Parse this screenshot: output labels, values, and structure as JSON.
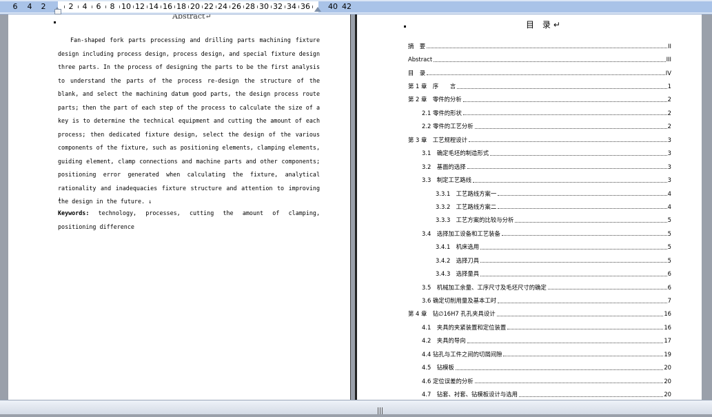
{
  "ruler": {
    "numbers": [
      "6",
      "4",
      "2",
      "2",
      "4",
      "6",
      "8",
      "10",
      "12",
      "14",
      "16",
      "18",
      "20",
      "22",
      "24",
      "26",
      "28",
      "30",
      "32",
      "34",
      "36",
      "40",
      "42"
    ]
  },
  "left_page": {
    "title": "Abstract↵",
    "body": "Fan-shaped fork parts processing and drilling parts machining fixture design including process design, process design, and special fixture design three parts. In the process of designing the parts to be the first analysis to understand the parts of the process re-design the structure of the blank, and select the machining datum good parts, the design process route parts; then the part of each step of the process to calculate the size of a key is to determine the technical equipment and cutting the amount of each process; then dedicated fixture design, select the design of the various components of the fixture, such as positioning elements, clamping elements, guiding element, clamp connections and machine parts and other components; positioning error generated when calculating the fixture, analytical rationality and inadequacies fixture structure and attention to improving the design in the future. ↓",
    "empty_line": "↓",
    "keywords_label": "Keywords:",
    "keywords_text": " technology, processes, cutting the amount of clamping, positioning difference"
  },
  "right_page": {
    "toc_title": "目 录↵",
    "entries": [
      {
        "label": "摘　要",
        "page": "II",
        "level": 1
      },
      {
        "label": "Abstract",
        "page": "III",
        "level": 1
      },
      {
        "label": "目　录",
        "page": "IV",
        "level": 1
      },
      {
        "label": "第 1 章　序　　言",
        "page": "1",
        "level": 1
      },
      {
        "label": "第 2 章　零件的分析",
        "page": "2",
        "level": 1
      },
      {
        "label": "2.1 零件的形状",
        "page": "2",
        "level": 2
      },
      {
        "label": "2.2 零件的工艺分析",
        "page": "2",
        "level": 2
      },
      {
        "label": "第 3 章　工艺规程设计",
        "page": "3",
        "level": 1
      },
      {
        "label": "3.1　确定毛坯的制造形式",
        "page": "3",
        "level": 2
      },
      {
        "label": "3.2　基面的选择",
        "page": "3",
        "level": 2
      },
      {
        "label": "3.3　制定工艺路线",
        "page": "3",
        "level": 2
      },
      {
        "label": "3.3.1　工艺路线方案一",
        "page": "4",
        "level": 3
      },
      {
        "label": "3.3.2　工艺路线方案二",
        "page": "4",
        "level": 3
      },
      {
        "label": "3.3.3　工艺方案的比较与分析",
        "page": "5",
        "level": 3
      },
      {
        "label": "3.4　选择加工设备和工艺装备",
        "page": "5",
        "level": 2
      },
      {
        "label": "3.4.1　机床选用",
        "page": "5",
        "level": 3
      },
      {
        "label": "3.4.2　选择刀具",
        "page": "5",
        "level": 3
      },
      {
        "label": "3.4.3　选择量具",
        "page": "6",
        "level": 3
      },
      {
        "label": "3.5　机械加工余量、工序尺寸及毛坯尺寸的确定",
        "page": "6",
        "level": 2
      },
      {
        "label": "3.6 确定切削用量及基本工时",
        "page": "7",
        "level": 2
      },
      {
        "label": "第 4 章　钻∅16H7 孔孔夹具设计",
        "page": "16",
        "level": 1
      },
      {
        "label": "4.1　夹具的夹紧装置和定位装置",
        "page": "16",
        "level": 2
      },
      {
        "label": "4.2　夹具的导向",
        "page": "17",
        "level": 2
      },
      {
        "label": "4.4 钻孔与工件之间的切屑间隙",
        "page": "19",
        "level": 2
      },
      {
        "label": "4.5　钻模板",
        "page": "20",
        "level": 2
      },
      {
        "label": "4.6 定位误差的分析",
        "page": "20",
        "level": 2
      },
      {
        "label": "4.7　钻套、衬套、钻模板设计与选用",
        "page": "20",
        "level": 2
      }
    ]
  }
}
